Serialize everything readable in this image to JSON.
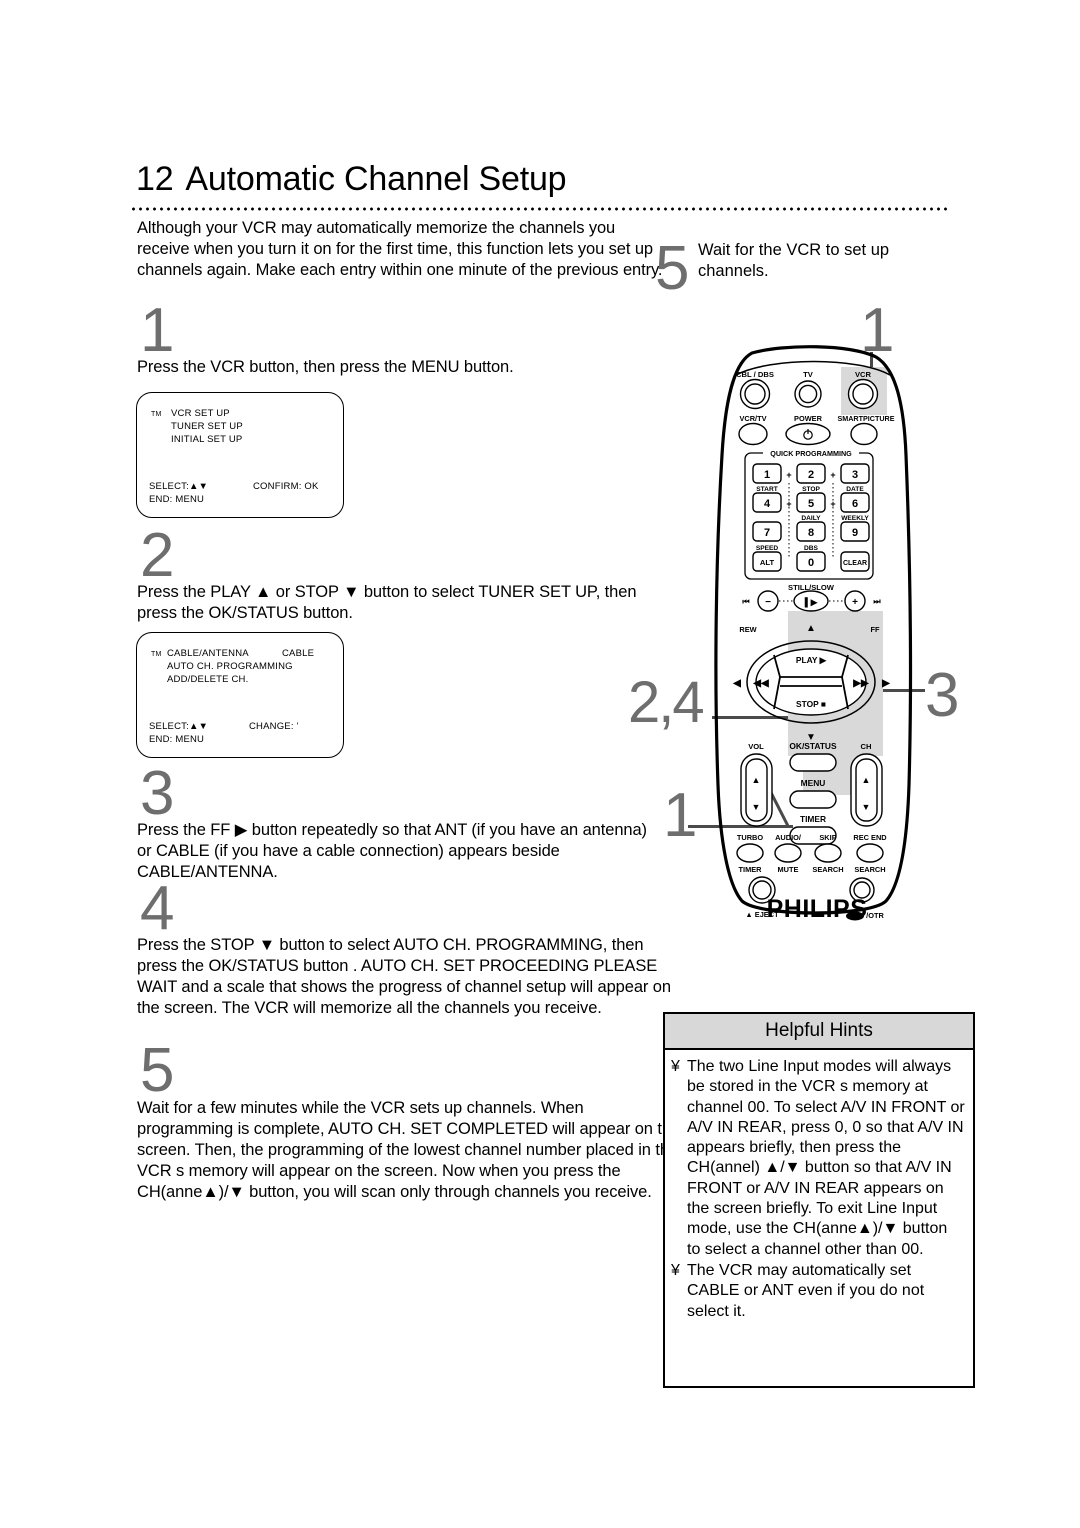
{
  "page": {
    "number": "12",
    "title": "Automatic Channel Setup"
  },
  "intro": "Although your VCR may automatically memorize the channels you receive when you turn it on for the first time, this function lets you set up channels again.  Make each entry within one minute of the previous entry.",
  "steps": [
    {
      "num": "1",
      "text": "Press the VCR button, then press the MENU    button."
    },
    {
      "num": "2",
      "text": "Press the PLAY  ▲ or STOP  ▼ button to select TUNER SET UP, then press the OK/STATUS    button."
    },
    {
      "num": "3",
      "text": "Press the FF ▶ button repeatedly so that ANT (if you have an antenna) or CABLE   (if you have a cable connection) appears beside CABLE/ANTENNA."
    },
    {
      "num": "4",
      "text": "Press the STOP  ▼ button to select AUTO CH. PROGRAMMING, then press the OK/STATUS     button . AUTO CH. SET PROCEEDING PLEASE WAIT and a scale that shows the progress of channel setup will appear on the screen. The VCR will memorize all the channels you receive."
    },
    {
      "num": "5",
      "text": "Wait for a few minutes while the VCR sets up channels. When programming is complete, AUTO CH. SET COMPLETED will appear on the screen. Then, the programming of the lowest channel number placed in the VCR s memory will appear on the screen. Now when you press the CH(anne▲)/▼ button, you will scan only through channels you receive."
    }
  ],
  "osd_screens": [
    {
      "tm": "TM",
      "lines": [
        "VCR SET UP",
        "TUNER SET UP",
        "INITIAL SET UP"
      ],
      "footer_left": "SELECT:▲▼",
      "footer_right": "CONFIRM:  OK",
      "footer_end": "END:  MENU"
    },
    {
      "tm": "TM",
      "lines": [
        "CABLE/ANTENNA",
        "AUTO CH. PROGRAMMING",
        "ADD/DELETE CH."
      ],
      "value": "CABLE",
      "footer_left": "SELECT:▲▼",
      "footer_right": "CHANGE: ’",
      "footer_end": "END:  MENU"
    }
  ],
  "callouts": {
    "five": "5",
    "five_text": "Wait for the VCR to set up channels.",
    "one_top": "1",
    "three": "3",
    "two_four": "2,4",
    "one_bottom": "1"
  },
  "hints": {
    "title": "Helpful Hints",
    "bullet": "¥",
    "items": [
      "The two Line Input modes will always be stored in the VCR s memory at channel 00. To select A/V IN FRONT or A/V IN REAR, press 0, 0 so that A/V IN appears briefly, then press the CH(annel) ▲/▼ button so that A/V IN FRONT or A/V IN REAR appears on the screen briefly. To exit Line Input mode, use the CH(anne▲)/▼ button to select a channel other than 00.",
      "The VCR may automatically set CABLE or ANT even if you do not select it."
    ]
  },
  "remote": {
    "brand": "PHILIPS",
    "top_row": [
      "CBL / DBS",
      "TV",
      "VCR"
    ],
    "second_row": [
      "VCR/TV",
      "POWER",
      "SMARTPICTURE"
    ],
    "keypad_header": "QUICK PROGRAMMING",
    "keys": [
      "1",
      "2",
      "3",
      "4",
      "5",
      "6",
      "7",
      "8",
      "9",
      "ALT",
      "0",
      "CLEAR"
    ],
    "key_sublabels": [
      "START",
      "STOP",
      "DATE",
      "DAILY",
      "WEEKLY",
      "SPEED",
      "DBS"
    ],
    "still_slow": "STILL/SLOW",
    "nav": {
      "rew": "REW",
      "ff": "FF",
      "play": "PLAY ▶",
      "stop": "STOP ■"
    },
    "vol": "VOL",
    "ch": "CH",
    "ok_status": "OK/STATUS",
    "menu": "MENU",
    "timer": "TIMER",
    "bottom_row_top": [
      "TURBO",
      "AUDIO/",
      "SKIP",
      "REC END"
    ],
    "bottom_row_bottom": [
      "TIMER",
      "MUTE",
      "SEARCH",
      "SEARCH"
    ],
    "eject": "▲ EJECT",
    "rec_otr": "/OTR"
  },
  "colors": {
    "highlight": "#d9d9d9",
    "step_numeral": "#6e6e6e",
    "hints_header": "#d8d8d8"
  }
}
